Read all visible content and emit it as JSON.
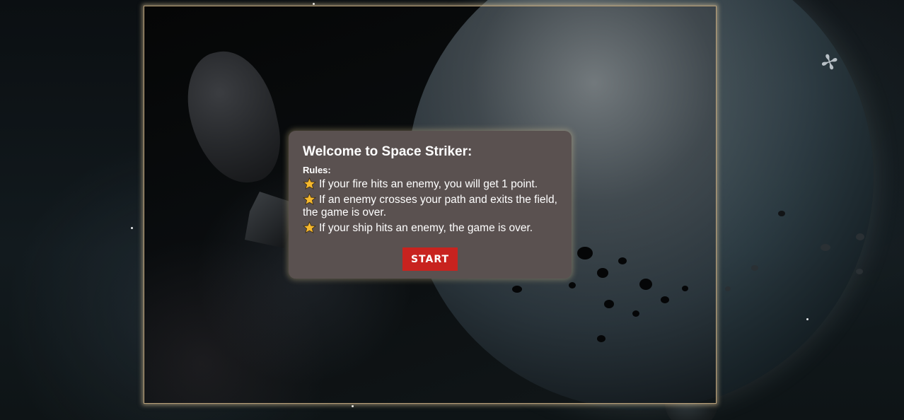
{
  "dialog": {
    "title": "Welcome to Space Striker:",
    "rules_heading": "Rules:",
    "rules": [
      "If your fire hits an enemy, you will get 1 point.",
      "If an enemy crosses your path and exits the field, the game is over.",
      "If your ship hits an enemy, the game is over."
    ],
    "start_label": "START"
  },
  "icons": {
    "rule_bullet": "star-icon",
    "background_satellite": "satellite-icon"
  },
  "colors": {
    "dialog_background": "#5a5150",
    "start_button": "#c8231f",
    "star_fill": "#f5b82e",
    "frame_border": "#b89f78"
  }
}
